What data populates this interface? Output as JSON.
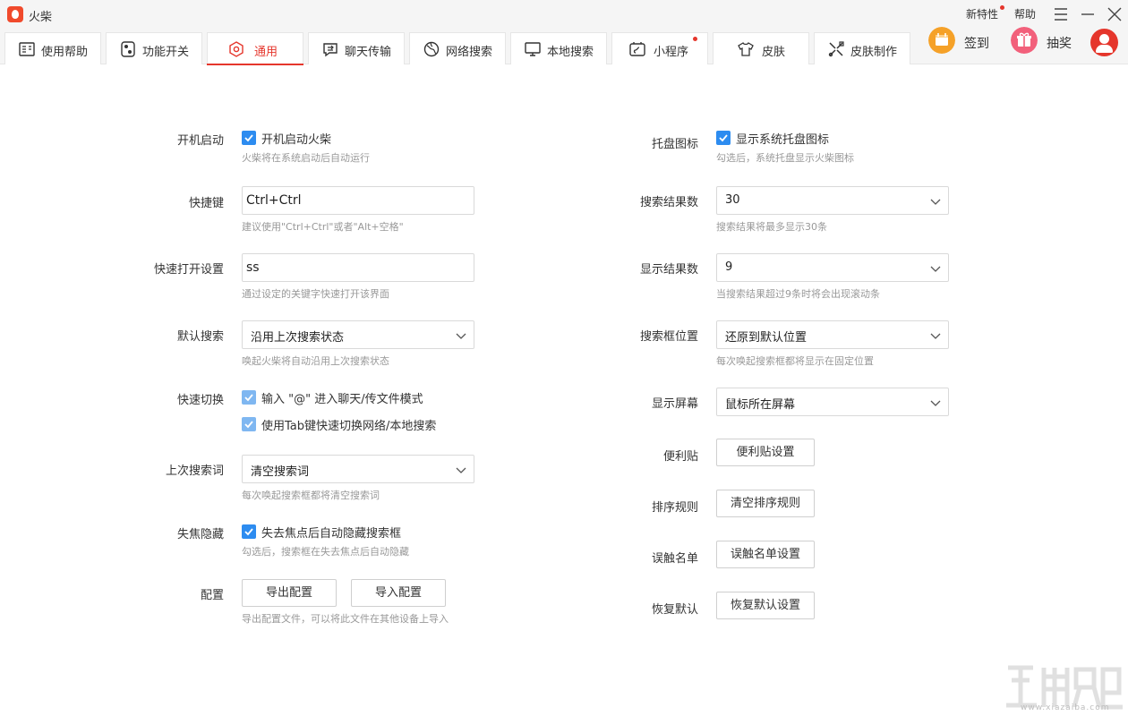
{
  "window": {
    "title": "火柴",
    "links": {
      "new_features": "新特性",
      "help": "帮助"
    }
  },
  "tabs": [
    {
      "label": "使用帮助",
      "icon": "help-doc-icon"
    },
    {
      "label": "功能开关",
      "icon": "toggle-switch-icon"
    },
    {
      "label": "通用",
      "icon": "gear-icon",
      "active": true
    },
    {
      "label": "聊天传输",
      "icon": "chat-transfer-icon"
    },
    {
      "label": "网络搜索",
      "icon": "globe-icon"
    },
    {
      "label": "本地搜索",
      "icon": "monitor-icon"
    },
    {
      "label": "小程序",
      "icon": "mini-program-icon",
      "badge": true
    },
    {
      "label": "皮肤",
      "icon": "tshirt-icon"
    },
    {
      "label": "皮肤制作",
      "icon": "tools-icon"
    }
  ],
  "actions": {
    "checkin": "签到",
    "lottery": "抽奖"
  },
  "colors": {
    "accent": "#e5362c",
    "checkbox": "#2d8cf0",
    "checkin_orange": "#f5a128",
    "lottery_pink": "#f2607b"
  },
  "left": {
    "startup": {
      "label": "开机启动",
      "checkbox": "开机启动火柴",
      "hint": "火柴将在系统启动后自动运行"
    },
    "hotkey": {
      "label": "快捷键",
      "value": "Ctrl+Ctrl",
      "hint": "建议使用\"Ctrl+Ctrl\"或者\"Alt+空格\""
    },
    "quick_open": {
      "label": "快速打开设置",
      "value": "ss",
      "hint": "通过设定的关键字快速打开该界面"
    },
    "default_search": {
      "label": "默认搜索",
      "value": "沿用上次搜索状态",
      "hint": "唤起火柴将自动沿用上次搜索状态"
    },
    "quick_switch": {
      "label": "快速切换",
      "option1": "输入 \"@\" 进入聊天/传文件模式",
      "option2": "使用Tab键快速切换网络/本地搜索"
    },
    "last_query": {
      "label": "上次搜索词",
      "value": "清空搜索词",
      "hint": "每次唤起搜索框都将清空搜索词"
    },
    "blur_hide": {
      "label": "失焦隐藏",
      "checkbox": "失去焦点后自动隐藏搜索框",
      "hint": "勾选后，搜索框在失去焦点后自动隐藏"
    },
    "config": {
      "label": "配置",
      "export": "导出配置",
      "import": "导入配置",
      "hint": "导出配置文件，可以将此文件在其他设备上导入"
    }
  },
  "right": {
    "tray": {
      "label": "托盘图标",
      "checkbox": "显示系统托盘图标",
      "hint": "勾选后，系统托盘显示火柴图标"
    },
    "result_count": {
      "label": "搜索结果数",
      "value": "30",
      "hint": "搜索结果将最多显示30条"
    },
    "display_count": {
      "label": "显示结果数",
      "value": "9",
      "hint": "当搜索结果超过9条时将会出现滚动条"
    },
    "box_position": {
      "label": "搜索框位置",
      "value": "还原到默认位置",
      "hint": "每次唤起搜索框都将显示在固定位置"
    },
    "screen": {
      "label": "显示屏幕",
      "value": "鼠标所在屏幕"
    },
    "sticky": {
      "label": "便利贴",
      "button": "便利贴设置"
    },
    "sort": {
      "label": "排序规则",
      "button": "清空排序规则"
    },
    "mistouch": {
      "label": "误触名单",
      "button": "误触名单设置"
    },
    "restore": {
      "label": "恢复默认",
      "button": "恢复默认设置"
    }
  },
  "watermark": {
    "text": "www.xiazaiba.com"
  }
}
